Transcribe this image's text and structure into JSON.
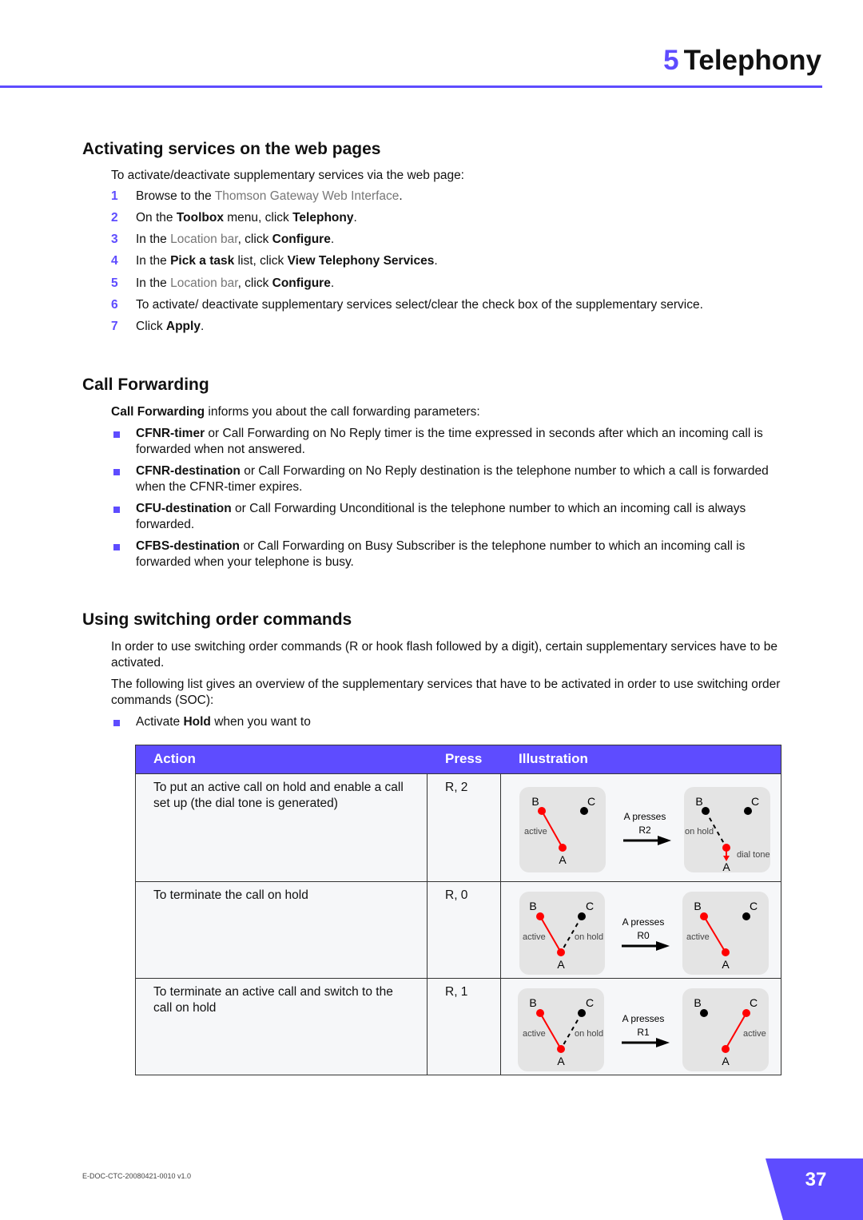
{
  "header": {
    "chapter_number": "5",
    "chapter_title": "Telephony"
  },
  "section1": {
    "title": "Activating services on the web pages",
    "intro": "To activate/deactivate supplementary services via the web page:",
    "steps": [
      {
        "n": "1",
        "a": "Browse to the ",
        "link": "Thomson Gateway Web Interface",
        "b": "."
      },
      {
        "n": "2",
        "a": "On the ",
        "b1": "Toolbox",
        "c": " menu, click ",
        "b2": "Telephony",
        "d": "."
      },
      {
        "n": "3",
        "a": "In the ",
        "link": "Location bar",
        "c": ", click ",
        "b2": "Configure",
        "d": "."
      },
      {
        "n": "4",
        "a": "In the ",
        "b1": "Pick a task",
        "c": " list, click ",
        "b2": "View Telephony Services",
        "d": "."
      },
      {
        "n": "5",
        "a": "In the ",
        "link": "Location bar",
        "c": ", click ",
        "b2": "Configure",
        "d": "."
      },
      {
        "n": "6",
        "a": "To activate/ deactivate supplementary services select/clear the check box of the supplementary service."
      },
      {
        "n": "7",
        "a": "Click ",
        "b2": "Apply",
        "d": "."
      }
    ]
  },
  "section2": {
    "title": "Call Forwarding",
    "intro_bold": "Call Forwarding",
    "intro": " informs you about the call forwarding parameters:",
    "bullets": [
      {
        "term": "CFNR-timer",
        "text": " or Call Forwarding on No Reply timer is the time expressed in seconds after which an incoming call is forwarded when not answered."
      },
      {
        "term": "CFNR-destination",
        "text": " or Call Forwarding on No Reply destination is the telephone number to which a call is forwarded when the CFNR-timer expires."
      },
      {
        "term": "CFU-destination",
        "text": " or Call Forwarding Unconditional is the telephone number to which an incoming call is always forwarded."
      },
      {
        "term": "CFBS-destination",
        "text": " or Call Forwarding on Busy Subscriber is the telephone number to which an incoming call is forwarded when your telephone is busy."
      }
    ]
  },
  "section3": {
    "title": "Using switching order commands",
    "p1": "In order to use switching order commands (R or hook flash followed by a digit), certain supplementary services have to be activated.",
    "p2": "The following list gives an overview of the supplementary services that have to be activated in order to use switching order commands (SOC):",
    "bullet_a": "Activate ",
    "bullet_b": "Hold",
    "bullet_c": " when you want to"
  },
  "table": {
    "headers": [
      "Action",
      "Press",
      "Illustration"
    ],
    "rows": [
      {
        "action": "To put an active call on hold and enable a call set up (the dial tone is generated)",
        "press": "R, 2",
        "presses": "A presses",
        "key": "R2"
      },
      {
        "action": "To terminate the call on hold",
        "press": "R, 0",
        "presses": "A presses",
        "key": "R0"
      },
      {
        "action": "To terminate an active call and switch to the call on hold",
        "press": "R, 1",
        "presses": "A presses",
        "key": "R1"
      }
    ],
    "labels": {
      "a": "A",
      "b": "B",
      "c": "C",
      "active": "active",
      "on_hold": "on hold",
      "dial_tone": "dial tone"
    }
  },
  "colors": {
    "accent": "#5e4cff",
    "active_line": "#ff0000"
  },
  "footer": {
    "doc_id": "E-DOC-CTC-20080421-0010 v1.0",
    "page": "37"
  }
}
